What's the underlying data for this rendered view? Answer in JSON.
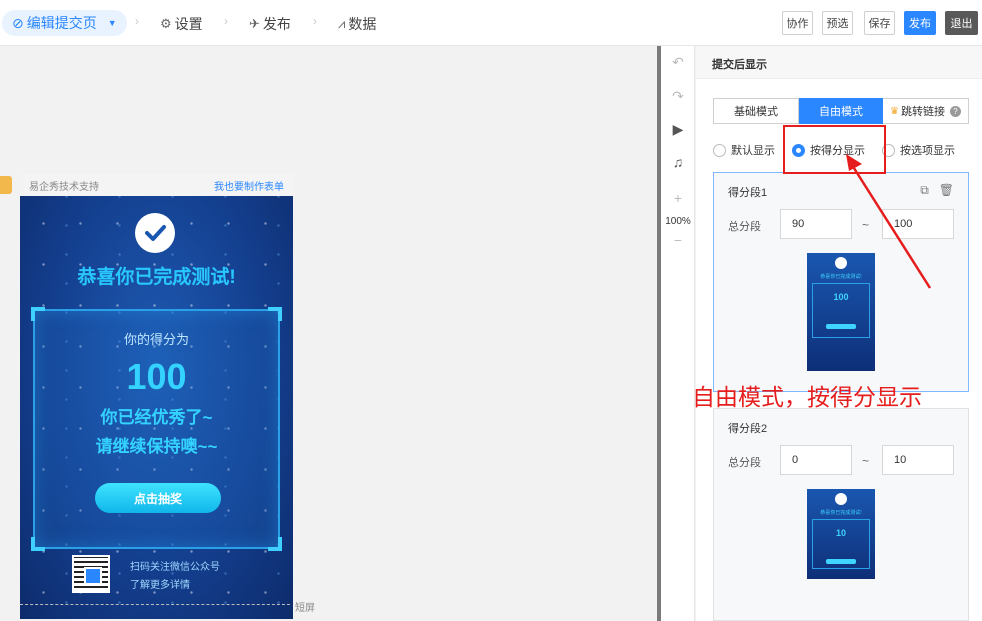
{
  "topbar": {
    "edit_tab": "编辑提交页",
    "settings_tab": "设置",
    "publish_tab": "发布",
    "data_tab": "数据",
    "buttons": {
      "collaborate": "协作",
      "preview": "预选",
      "save": "保存",
      "publish": "发布",
      "exit": "退出"
    }
  },
  "canvas": {
    "header_left": "易企秀技术支持",
    "header_right": "我也要制作表单",
    "congrats": "恭喜你已完成测试!",
    "score_label": "你的得分为",
    "score_value": "100",
    "msg1": "你已经优秀了~",
    "msg2": "请继续保持噢~~",
    "draw_button": "点击抽奖",
    "follow_line1": "扫码关注微信公众号",
    "follow_line2": "了解更多详情",
    "short_screen": "短屏"
  },
  "toolbar": {
    "zoom": "100%"
  },
  "panel": {
    "title": "提交后显示",
    "tabs": {
      "basic": "基础模式",
      "free": "自由模式",
      "jump": "跳转链接"
    },
    "radios": {
      "default": "默认显示",
      "by_score": "按得分显示",
      "by_option": "按选项显示"
    },
    "segments": [
      {
        "title": "得分段1",
        "label": "总分段",
        "from": "90",
        "to": "100",
        "thumb_score": "100"
      },
      {
        "title": "得分段2",
        "label": "总分段",
        "from": "0",
        "to": "10",
        "thumb_score": "10"
      }
    ],
    "tilde": "~"
  },
  "annotation": "自由模式，按得分显示",
  "colors": {
    "accent": "#2b87ff",
    "annotation_red": "#e51d1d"
  }
}
